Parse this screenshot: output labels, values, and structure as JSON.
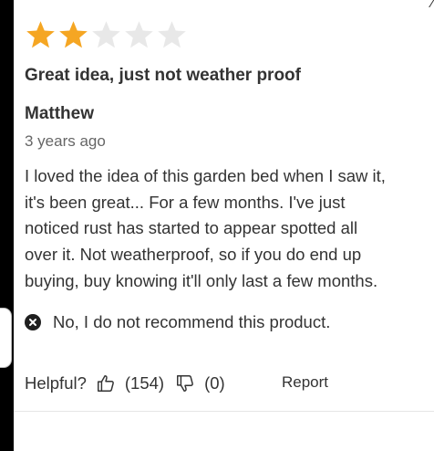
{
  "review": {
    "rating": 2,
    "max_rating": 5,
    "star_filled_color": "#f5a623",
    "star_empty_color": "#e8e8e8",
    "title": "Great idea, just not weather proof",
    "author": "Matthew",
    "date": "3 years ago",
    "body_lines": [
      "I loved the idea of this garden bed when I saw it,",
      "it's been great... For a few months. I've just",
      "noticed rust has started to appear spotted all",
      "over it. Not weatherproof, so if you do end up",
      "buying, buy knowing it'll only last a few months."
    ],
    "recommendation": {
      "icon": "x-circle-icon",
      "text": "No, I do not recommend this product."
    }
  },
  "feedback": {
    "helpful_label": "Helpful?",
    "upvote_icon": "thumbs-up-icon",
    "upvote_count": "(154)",
    "downvote_icon": "thumbs-down-icon",
    "downvote_count": "(0)",
    "report_label": "Report"
  }
}
